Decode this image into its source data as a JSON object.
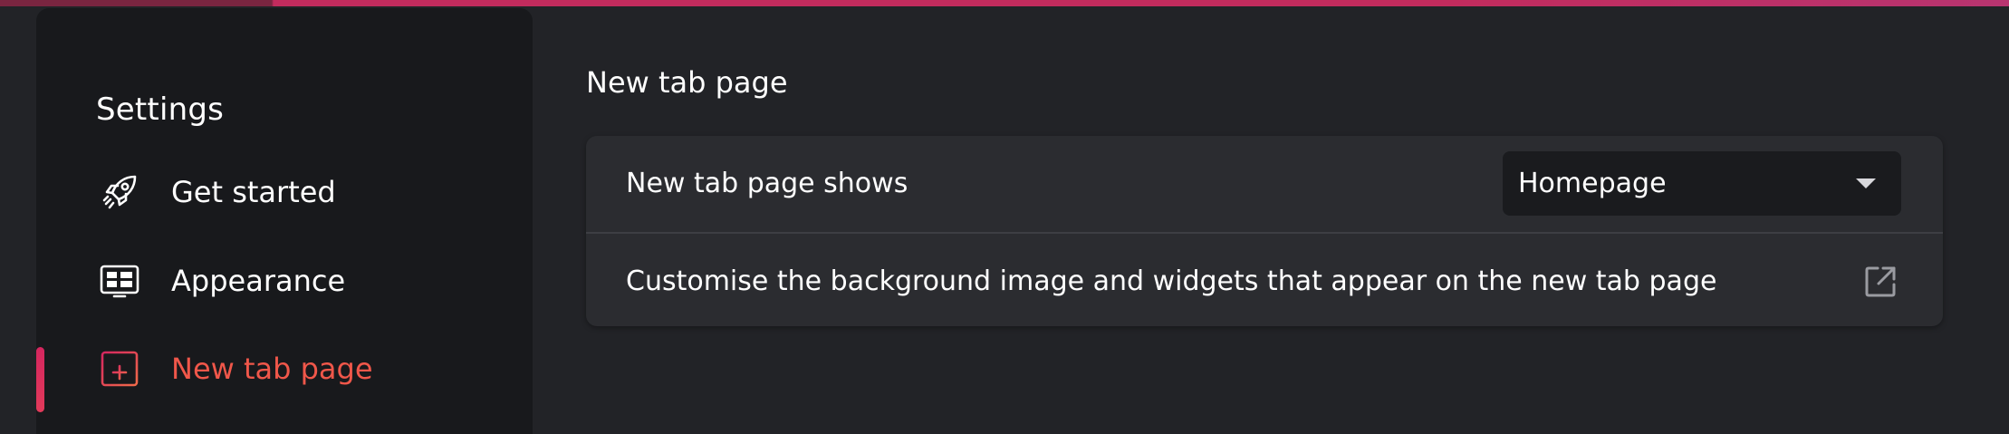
{
  "sidebar": {
    "title": "Settings",
    "items": [
      {
        "label": "Get started",
        "icon": "rocket-icon"
      },
      {
        "label": "Appearance",
        "icon": "appearance-icon"
      },
      {
        "label": "New tab page",
        "icon": "new-tab-page-icon",
        "active": true
      }
    ]
  },
  "main": {
    "heading": "New tab page",
    "rows": [
      {
        "label": "New tab page shows",
        "select_value": "Homepage"
      },
      {
        "label": "Customise the background image and widgets that appear on the new tab page",
        "icon": "external-link-icon"
      }
    ]
  },
  "colors": {
    "accent": "#f0574a",
    "indicator": "#d5265f",
    "background": "#222327",
    "sidebar": "#18191c",
    "card": "#2b2c30"
  }
}
